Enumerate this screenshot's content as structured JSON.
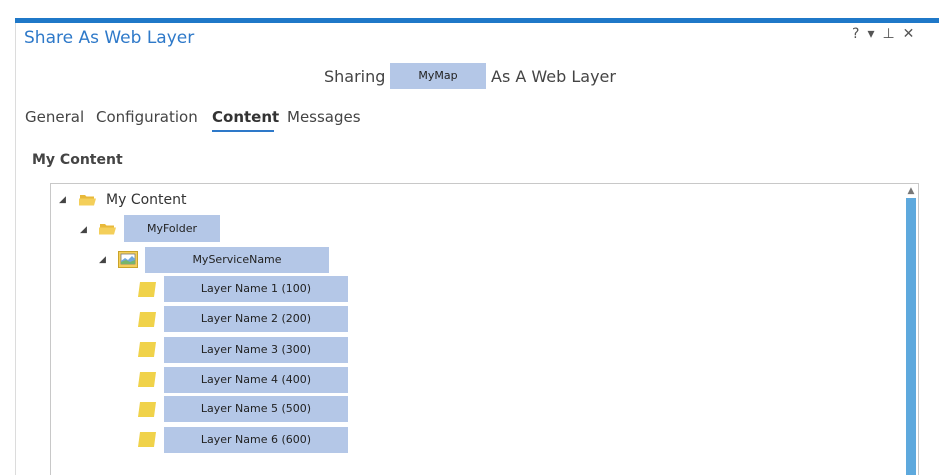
{
  "window": {
    "title": "Share As Web Layer",
    "help_glyph": "?",
    "dropdown_glyph": "▾",
    "pin_glyph": "⊥",
    "close_glyph": "✕"
  },
  "sharing": {
    "prefix": "Sharing",
    "map_name": "MyMap",
    "suffix": "As A Web Layer"
  },
  "tabs": [
    {
      "label": "General",
      "active": false
    },
    {
      "label": "Configuration",
      "active": false
    },
    {
      "label": "Content",
      "active": true
    },
    {
      "label": "Messages",
      "active": false
    }
  ],
  "content": {
    "section_title": "My Content",
    "root": {
      "label": "My Content",
      "expander": "◢"
    },
    "folder": {
      "label": "MyFolder",
      "expander": "◢"
    },
    "service": {
      "label": "MyServiceName",
      "expander": "◢"
    },
    "layers": [
      "Layer Name 1  (100)",
      "Layer Name 2  (200)",
      "Layer Name 3  (300)",
      "Layer Name 4  (400)",
      "Layer Name 5  (500)",
      "Layer Name 6  (600)"
    ]
  },
  "colors": {
    "accent": "#1f78c8",
    "highlight": "#b4c7e7",
    "scrollbar": "#5ea9dd",
    "folder": "#f0c94a"
  }
}
